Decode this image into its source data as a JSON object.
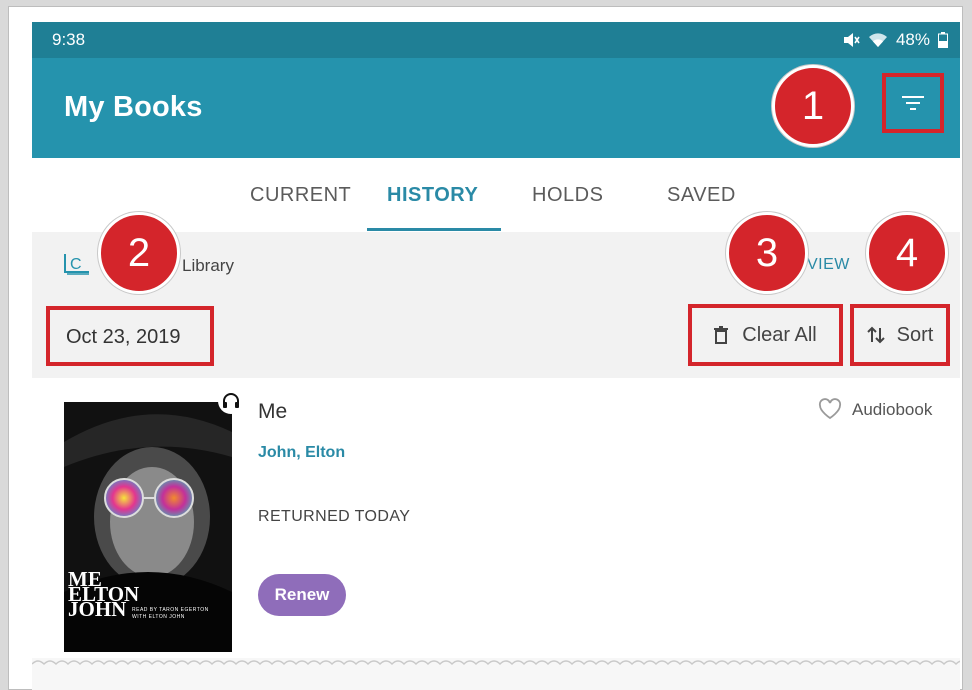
{
  "status_bar": {
    "time": "9:38",
    "battery": "48%"
  },
  "app_bar": {
    "title": "My Books"
  },
  "tabs": [
    {
      "label": "CURRENT"
    },
    {
      "label": "HISTORY",
      "active": true
    },
    {
      "label": "HOLDS"
    },
    {
      "label": "SAVED"
    }
  ],
  "library_bar": {
    "library_name": "Library",
    "view_label": "VIEW"
  },
  "history_header": {
    "date": "Oct 23, 2019",
    "clear_all_label": "Clear All",
    "sort_label": "Sort"
  },
  "book": {
    "title": "Me",
    "author": "John, Elton",
    "status": "RETURNED TODAY",
    "renew_label": "Renew",
    "format": "Audiobook",
    "cover_text": "ME ELTON JOHN",
    "cover_subtext": "READ BY TARON EGERTON WITH ELTON JOHN"
  },
  "callouts": [
    "1",
    "2",
    "3",
    "4"
  ],
  "colors": {
    "status_bar": "#1f7f95",
    "app_bar": "#2593ad",
    "accent": "#2a8aa6",
    "highlight": "#d4252b",
    "renew": "#8f6dba"
  }
}
